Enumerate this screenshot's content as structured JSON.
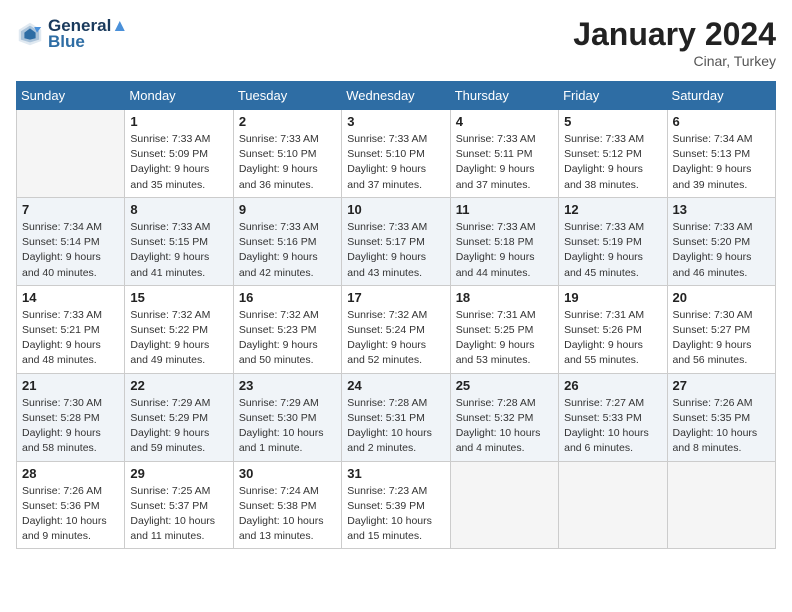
{
  "header": {
    "logo_line1": "General",
    "logo_line2": "Blue",
    "month": "January 2024",
    "location": "Cinar, Turkey"
  },
  "days_of_week": [
    "Sunday",
    "Monday",
    "Tuesday",
    "Wednesday",
    "Thursday",
    "Friday",
    "Saturday"
  ],
  "weeks": [
    [
      {
        "day": "",
        "info": ""
      },
      {
        "day": "1",
        "info": "Sunrise: 7:33 AM\nSunset: 5:09 PM\nDaylight: 9 hours\nand 35 minutes."
      },
      {
        "day": "2",
        "info": "Sunrise: 7:33 AM\nSunset: 5:10 PM\nDaylight: 9 hours\nand 36 minutes."
      },
      {
        "day": "3",
        "info": "Sunrise: 7:33 AM\nSunset: 5:10 PM\nDaylight: 9 hours\nand 37 minutes."
      },
      {
        "day": "4",
        "info": "Sunrise: 7:33 AM\nSunset: 5:11 PM\nDaylight: 9 hours\nand 37 minutes."
      },
      {
        "day": "5",
        "info": "Sunrise: 7:33 AM\nSunset: 5:12 PM\nDaylight: 9 hours\nand 38 minutes."
      },
      {
        "day": "6",
        "info": "Sunrise: 7:34 AM\nSunset: 5:13 PM\nDaylight: 9 hours\nand 39 minutes."
      }
    ],
    [
      {
        "day": "7",
        "info": "Sunrise: 7:34 AM\nSunset: 5:14 PM\nDaylight: 9 hours\nand 40 minutes."
      },
      {
        "day": "8",
        "info": "Sunrise: 7:33 AM\nSunset: 5:15 PM\nDaylight: 9 hours\nand 41 minutes."
      },
      {
        "day": "9",
        "info": "Sunrise: 7:33 AM\nSunset: 5:16 PM\nDaylight: 9 hours\nand 42 minutes."
      },
      {
        "day": "10",
        "info": "Sunrise: 7:33 AM\nSunset: 5:17 PM\nDaylight: 9 hours\nand 43 minutes."
      },
      {
        "day": "11",
        "info": "Sunrise: 7:33 AM\nSunset: 5:18 PM\nDaylight: 9 hours\nand 44 minutes."
      },
      {
        "day": "12",
        "info": "Sunrise: 7:33 AM\nSunset: 5:19 PM\nDaylight: 9 hours\nand 45 minutes."
      },
      {
        "day": "13",
        "info": "Sunrise: 7:33 AM\nSunset: 5:20 PM\nDaylight: 9 hours\nand 46 minutes."
      }
    ],
    [
      {
        "day": "14",
        "info": "Sunrise: 7:33 AM\nSunset: 5:21 PM\nDaylight: 9 hours\nand 48 minutes."
      },
      {
        "day": "15",
        "info": "Sunrise: 7:32 AM\nSunset: 5:22 PM\nDaylight: 9 hours\nand 49 minutes."
      },
      {
        "day": "16",
        "info": "Sunrise: 7:32 AM\nSunset: 5:23 PM\nDaylight: 9 hours\nand 50 minutes."
      },
      {
        "day": "17",
        "info": "Sunrise: 7:32 AM\nSunset: 5:24 PM\nDaylight: 9 hours\nand 52 minutes."
      },
      {
        "day": "18",
        "info": "Sunrise: 7:31 AM\nSunset: 5:25 PM\nDaylight: 9 hours\nand 53 minutes."
      },
      {
        "day": "19",
        "info": "Sunrise: 7:31 AM\nSunset: 5:26 PM\nDaylight: 9 hours\nand 55 minutes."
      },
      {
        "day": "20",
        "info": "Sunrise: 7:30 AM\nSunset: 5:27 PM\nDaylight: 9 hours\nand 56 minutes."
      }
    ],
    [
      {
        "day": "21",
        "info": "Sunrise: 7:30 AM\nSunset: 5:28 PM\nDaylight: 9 hours\nand 58 minutes."
      },
      {
        "day": "22",
        "info": "Sunrise: 7:29 AM\nSunset: 5:29 PM\nDaylight: 9 hours\nand 59 minutes."
      },
      {
        "day": "23",
        "info": "Sunrise: 7:29 AM\nSunset: 5:30 PM\nDaylight: 10 hours\nand 1 minute."
      },
      {
        "day": "24",
        "info": "Sunrise: 7:28 AM\nSunset: 5:31 PM\nDaylight: 10 hours\nand 2 minutes."
      },
      {
        "day": "25",
        "info": "Sunrise: 7:28 AM\nSunset: 5:32 PM\nDaylight: 10 hours\nand 4 minutes."
      },
      {
        "day": "26",
        "info": "Sunrise: 7:27 AM\nSunset: 5:33 PM\nDaylight: 10 hours\nand 6 minutes."
      },
      {
        "day": "27",
        "info": "Sunrise: 7:26 AM\nSunset: 5:35 PM\nDaylight: 10 hours\nand 8 minutes."
      }
    ],
    [
      {
        "day": "28",
        "info": "Sunrise: 7:26 AM\nSunset: 5:36 PM\nDaylight: 10 hours\nand 9 minutes."
      },
      {
        "day": "29",
        "info": "Sunrise: 7:25 AM\nSunset: 5:37 PM\nDaylight: 10 hours\nand 11 minutes."
      },
      {
        "day": "30",
        "info": "Sunrise: 7:24 AM\nSunset: 5:38 PM\nDaylight: 10 hours\nand 13 minutes."
      },
      {
        "day": "31",
        "info": "Sunrise: 7:23 AM\nSunset: 5:39 PM\nDaylight: 10 hours\nand 15 minutes."
      },
      {
        "day": "",
        "info": ""
      },
      {
        "day": "",
        "info": ""
      },
      {
        "day": "",
        "info": ""
      }
    ]
  ]
}
